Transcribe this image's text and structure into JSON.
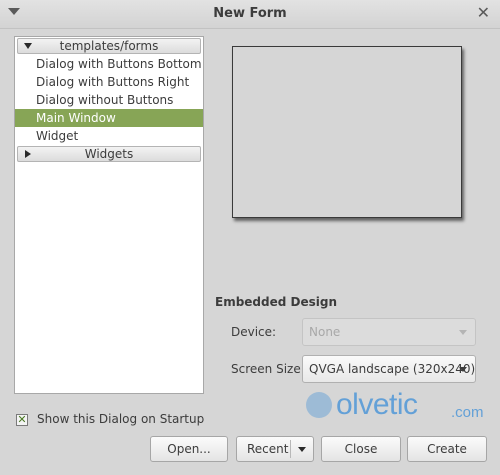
{
  "window": {
    "title": "New Form"
  },
  "templates": {
    "group_forms": "templates/forms",
    "items": [
      "Dialog with Buttons Bottom",
      "Dialog with Buttons Right",
      "Dialog without Buttons",
      "Main Window",
      "Widget"
    ],
    "selected": "Main Window",
    "group_widgets": "Widgets"
  },
  "embedded": {
    "title": "Embedded Design",
    "device_label": "Device:",
    "device_value": "None",
    "screen_size_label": "Screen Size:",
    "screen_size_value": "QVGA landscape (320x240)"
  },
  "startup": {
    "label": "Show this Dialog on Startup",
    "checked": true
  },
  "buttons": {
    "open": "Open...",
    "recent": "Recent",
    "close": "Close",
    "create": "Create"
  },
  "watermark": {
    "brand": "olvetic",
    "tld": ".com"
  },
  "colors": {
    "selection": "#87a556",
    "watermark": "#3d8fd8"
  }
}
